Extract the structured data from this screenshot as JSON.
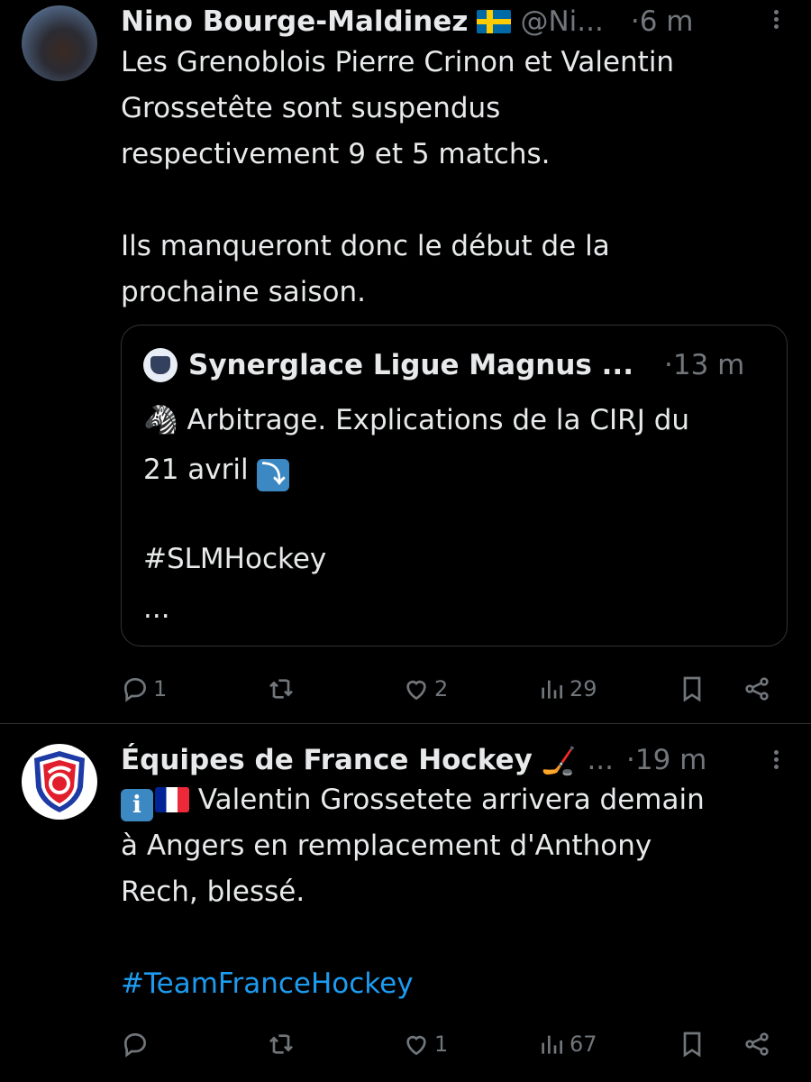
{
  "tweets": [
    {
      "author": "Nino Bourge-Maldinez",
      "handle": "@Ni...",
      "time": "6 m",
      "text_lines": [
        "Les Grenoblois Pierre Crinon et Valentin",
        "Grossetête sont suspendus",
        "respectivement 9 et 5 matchs.",
        "",
        "Ils manqueront donc le début de la",
        "prochaine saison."
      ],
      "quote": {
        "author": "Synerglace Ligue Magnus ...",
        "time": "13 m",
        "line1": "Arbitrage. Explications de la CIRJ du",
        "line2": "21 avril",
        "emoji_zebra": "🦓",
        "emoji_arrow": "⤵",
        "hashtag": "#SLMHockey",
        "ellipsis": "..."
      },
      "actions": {
        "replies": "1",
        "retweets": "",
        "likes": "2",
        "views": "29"
      }
    },
    {
      "author": "Équipes de France Hockey",
      "author_emoji": "🏒",
      "handle": "...",
      "time": "19 m",
      "info_emoji": "i",
      "text_lines": [
        "Valentin Grossetete arrivera demain",
        "à Angers en remplacement d'Anthony",
        "Rech, blessé."
      ],
      "hashtag": "#TeamFranceHockey",
      "actions": {
        "replies": "",
        "retweets": "",
        "likes": "1",
        "views": "67"
      }
    }
  ],
  "colors": {
    "background": "#000000",
    "text": "#e7e9ea",
    "muted": "#71767b",
    "link": "#1d9bf0",
    "border": "#2f3336"
  },
  "icons": [
    "more-icon",
    "reply-icon",
    "retweet-icon",
    "like-icon",
    "views-icon",
    "bookmark-icon",
    "share-icon"
  ]
}
